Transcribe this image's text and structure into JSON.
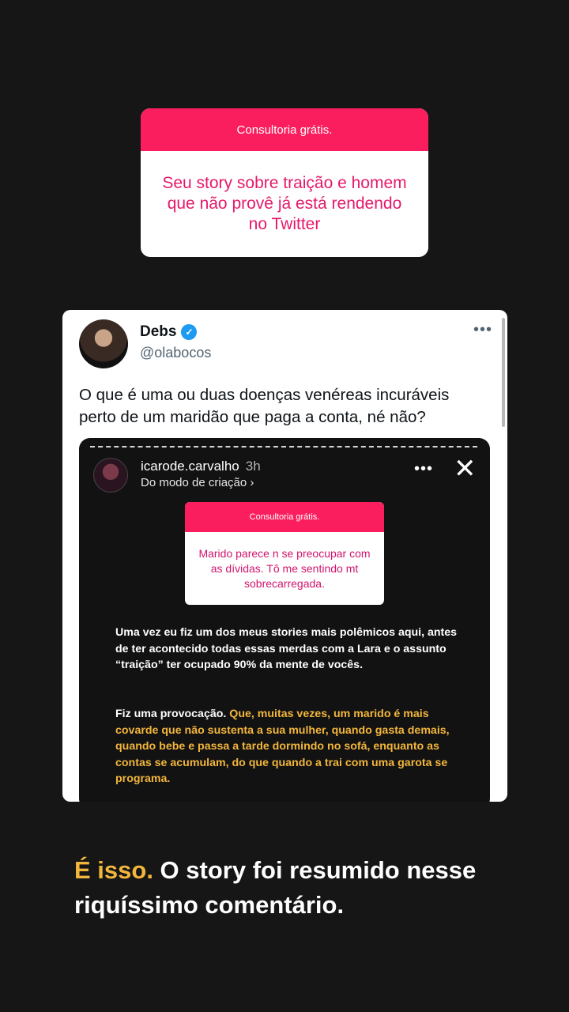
{
  "question_box": {
    "header": "Consultoria grátis.",
    "body": "Seu story sobre traição e homem que não provê já está rendendo no Twitter"
  },
  "tweet": {
    "name": "Debs",
    "handle": "@olabocos",
    "more": "•••",
    "text": "O que é uma ou duas doenças venéreas incuráveis perto de um maridão que paga a conta, né não?"
  },
  "embed": {
    "username": "icarode.carvalho",
    "time": "3h",
    "subtitle": "Do modo de criação ›",
    "more": "•••",
    "close": "✕",
    "question": {
      "header": "Consultoria grátis.",
      "body": "Marido parece n se preocupar com as dívidas. Tô me sentindo mt sobrecarregada."
    },
    "paragraph1": "Uma vez eu fiz um dos meus stories mais polêmicos aqui, antes de ter acontecido todas essas merdas com a Lara e o assunto “traição” ter ocupado 90% da mente de vocês.",
    "paragraph2_start": "Fiz uma provocação. ",
    "paragraph2_highlight": "Que, muitas vezes, um marido é mais covarde que não sustenta a sua mulher, quando gasta demais, quando bebe e passa a tarde dormindo no sofá, enquanto as contas se acumulam, do que quando a trai com uma garota se programa."
  },
  "caption": {
    "highlight": "É isso.",
    "rest": " O story foi resumido nesse riquíssimo comentário."
  },
  "colors": {
    "background": "#161616",
    "question_header": "#fb1e5e",
    "question_text": "#e5196b",
    "highlight_yellow": "#f3b63c",
    "verified_blue": "#1d9bf0"
  },
  "icons": [
    "verified-badge-icon",
    "more-icon",
    "close-icon"
  ]
}
